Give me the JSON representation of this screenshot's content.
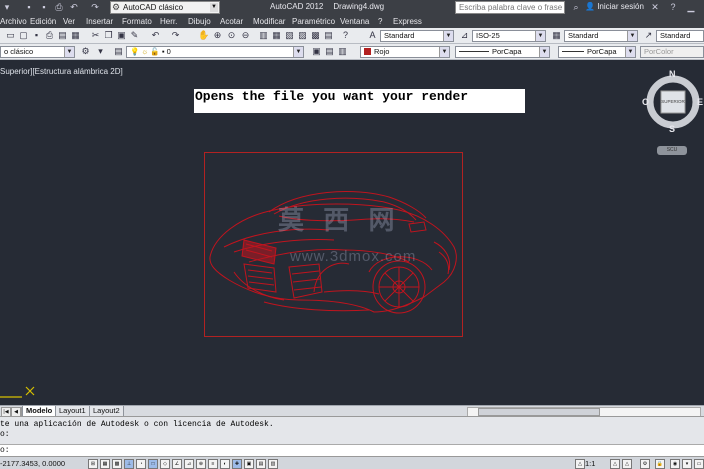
{
  "window": {
    "workspace": "AutoCAD clásico",
    "app_name": "AutoCAD 2012",
    "file_name": "Drawing4.dwg",
    "search_placeholder": "Escriba palabra clave o frase",
    "signin": "Iniciar sesión"
  },
  "menu": [
    "Archivo",
    "Edición",
    "Ver",
    "Insertar",
    "Formato",
    "Herr.",
    "Dibujo",
    "Acotar",
    "Modificar",
    "Paramétrico",
    "Ventana",
    "?",
    "Express"
  ],
  "toolbar1": {
    "text_style": "Standard",
    "dim_style": "ISO-25",
    "table_style": "Standard",
    "mleader_style": "Standard"
  },
  "toolbar2": {
    "workspace_combo": "o clásico",
    "layer": "0",
    "color": "Rojo",
    "linetype": "PorCapa",
    "lineweight": "PorCapa",
    "plotstyle": "PorColor"
  },
  "viewport": {
    "label": "Superior][Estructura alámbrica 2D]",
    "note": "Opens the file you want your render",
    "watermark_cn": "莫 西 网",
    "watermark_url": "www.3dmox.com"
  },
  "viewcube": {
    "north": "N",
    "south": "S",
    "east": "E",
    "west": "O",
    "face": "SUPERIOR",
    "wcs": "SCU"
  },
  "layouts": {
    "tabs": [
      "Modelo",
      "Layout1",
      "Layout2"
    ],
    "active_index": 0
  },
  "command": {
    "line1": "te una aplicación de Autodesk o con licencia de Autodesk.",
    "line2": "o:",
    "prompt": "o:"
  },
  "status": {
    "coords": "-2177.3453, 0.0000",
    "scale": "1:1"
  },
  "colors": {
    "drawing_red": "#c0141e",
    "background": "#262b35"
  }
}
